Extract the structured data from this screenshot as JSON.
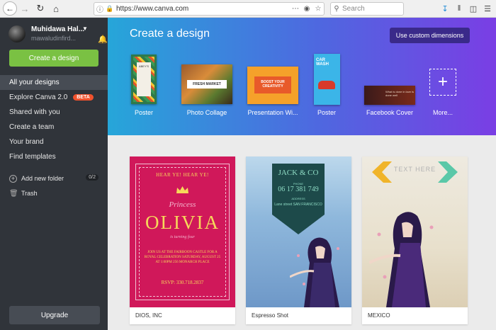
{
  "browser": {
    "url": "https://www.canva.com",
    "search_placeholder": "Search"
  },
  "sidebar": {
    "user_name": "Muhidawa Hal...",
    "user_sub": "mawaludinfird...",
    "create_button": "Create a design",
    "nav": [
      {
        "label": "All your designs",
        "active": true
      },
      {
        "label": "Explore Canva 2.0",
        "badge": "BETA"
      },
      {
        "label": "Shared with you"
      },
      {
        "label": "Create a team"
      },
      {
        "label": "Your brand"
      },
      {
        "label": "Find templates"
      }
    ],
    "add_folder": "Add new folder",
    "folder_count": "0/2",
    "trash": "Trash",
    "upgrade": "Upgrade"
  },
  "banner": {
    "title": "Create a design",
    "custom_dimensions": "Use custom dimensions",
    "templates": [
      {
        "label": "Poster"
      },
      {
        "label": "Photo Collage"
      },
      {
        "label": "Presentation Wi..."
      },
      {
        "label": "Poster"
      },
      {
        "label": "Facebook Cover"
      },
      {
        "label": "More..."
      }
    ],
    "thumb_text": {
      "poster1": "ABEY'S",
      "collage": "FRESH MARKET",
      "presentation": "BOOST YOUR CREATIVITY",
      "poster2": "CAR WASH",
      "facebook": "What is done in love is done well"
    }
  },
  "designs": [
    {
      "caption": "DIOS, INC",
      "hear": "HEAR YE! HEAR YE!",
      "princess": "Princess",
      "name": "OLIVIA",
      "sub": "is turning four",
      "details": "JOIN US AT THE FAIRBOON CASTLE FOR A ROYAL CELEBRATION SATURDAY, AUGUST 25 AT 1:00PM 256 MONARCH PLACE",
      "rsvp": "RSVP: 330.718.2837"
    },
    {
      "caption": "Espresso Shot",
      "brand": "JACK & CO",
      "phone_label": "PHONE",
      "phone": "06 17 381 749",
      "address_label": "ADDRESS",
      "address": "Lane street SAN FRANCISCO"
    },
    {
      "caption": "MEXICO",
      "text": "TEXT HERE"
    }
  ],
  "colors": {
    "sidebar_bg": "#30343a",
    "create_green": "#7ac143",
    "beta_red": "#f0522d",
    "banner_start": "#26a6d9",
    "banner_end": "#7a3ee4"
  }
}
